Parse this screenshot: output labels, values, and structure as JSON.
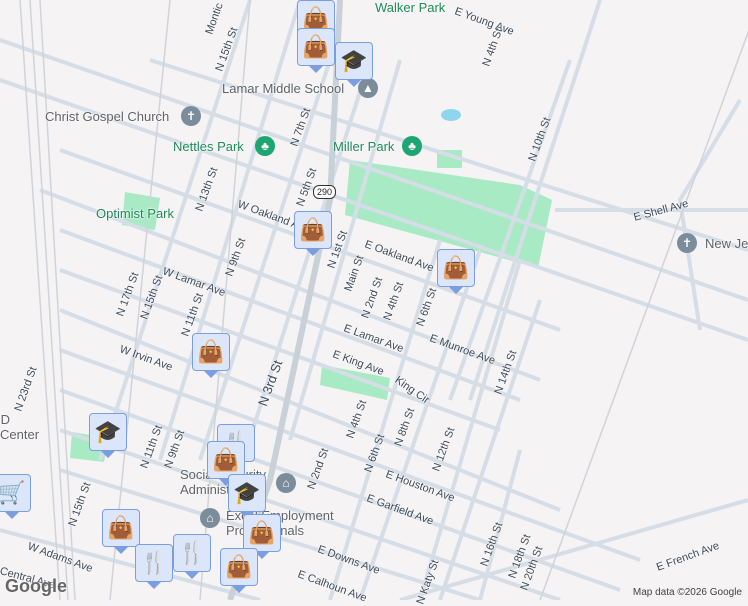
{
  "map": {
    "attribution": "Map data ©2026 Google",
    "logo": "Google",
    "highway_shield": "290",
    "parks": [
      "Walker Park",
      "Nettles Park",
      "Miller Park",
      "Optimist Park"
    ],
    "places": [
      "Lamar Middle School",
      "Christ Gospel Church",
      "New Je",
      "SD Center",
      "Social Security Administration",
      "Excel Employment Professionals"
    ],
    "streets": [
      "E Young Ave",
      "N 4th St",
      "N 10th St",
      "E Shell Ave",
      "N 15th St",
      "Montic",
      "N 7th St",
      "N 5th St",
      "N 13th St",
      "N 9th St",
      "W Oakland Ave",
      "E Oakland Ave",
      "N 1st St",
      "Main St",
      "N 2nd St",
      "N 4th St",
      "N 6th St",
      "W Lamar Ave",
      "N 17th St",
      "N 15th St",
      "N 11th St",
      "E Lamar Ave",
      "E Munroe Ave",
      "N 14th St",
      "W Irvin Ave",
      "E King Ave",
      "King Cir",
      "N 3rd St",
      "N 23rd St",
      "N 11th St",
      "N 9th St",
      "N 4th St",
      "N 6th St",
      "N 8th St",
      "N 12th St",
      "N 2nd St",
      "E Houston Ave",
      "E Garfield Ave",
      "N 15th St",
      "N 16th St",
      "N 18th St",
      "N 20th St",
      "N Katy St",
      "W Adams Ave",
      "Central Ave",
      "E Downs Ave",
      "E Calhoun Ave",
      "E French Ave"
    ],
    "marker_types": [
      "shopping-bag",
      "shopping-bag",
      "shopping-bag",
      "shopping-bag",
      "shopping-bag",
      "shopping-bag",
      "shopping-bag",
      "shopping-bag",
      "education",
      "education",
      "education",
      "restaurant",
      "restaurant",
      "restaurant",
      "shopping-cart"
    ]
  }
}
